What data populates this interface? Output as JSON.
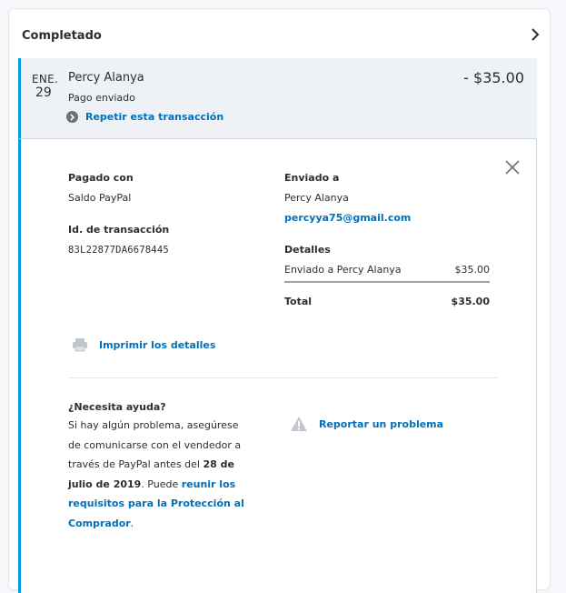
{
  "section": {
    "title": "Completado"
  },
  "transaction": {
    "month": "ENE.",
    "day": "29",
    "name": "Percy Alanya",
    "status": "Pago enviado",
    "amount": "- $35.00",
    "repeat_label": "Repetir esta transacción"
  },
  "details": {
    "paid_with_label": "Pagado con",
    "paid_with_value": "Saldo PayPal",
    "txn_id_label": "Id. de transacción",
    "txn_id_value": "83L22877DA6678445",
    "sent_to_label": "Enviado a",
    "sent_to_name": "Percy Alanya",
    "sent_to_email": "percyya75@gmail.com",
    "details_label": "Detalles",
    "line_item_label": "Enviado a Percy Alanya",
    "line_item_amount": "$35.00",
    "total_label": "Total",
    "total_amount": "$35.00",
    "print_label": "Imprimir los detalles"
  },
  "help": {
    "title": "¿Necesita ayuda?",
    "text_1": "Si hay algún problema, asegúrese de comunicarse con el vendedor a través de PayPal antes del ",
    "deadline": "28 de julio de 2019",
    "text_2": ". Puede ",
    "link": "reunir los requisitos para la Protección al Comprador",
    "text_3": ".",
    "report_label": "Reportar un problema"
  },
  "colors": {
    "accent": "#009cde",
    "link": "#0070ba",
    "icon": "#6c7378"
  }
}
